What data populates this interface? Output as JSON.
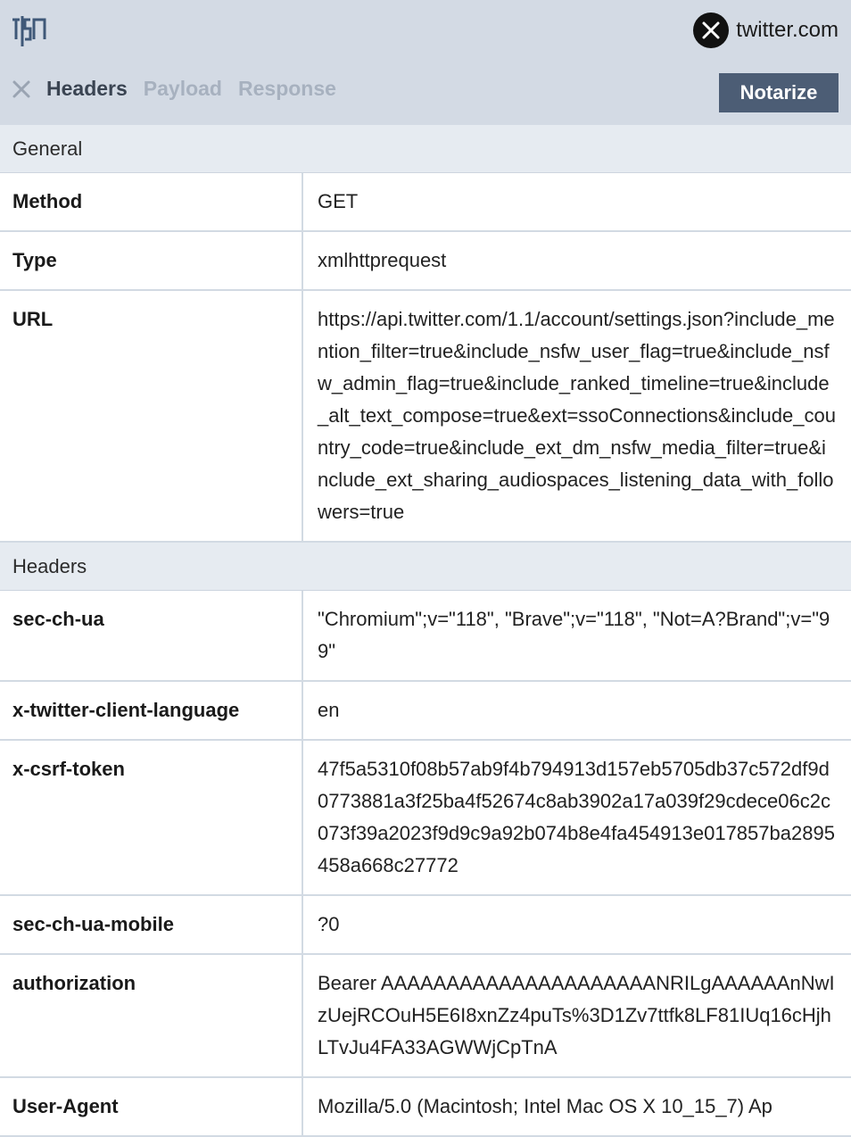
{
  "header": {
    "site": "twitter.com",
    "tabs": [
      {
        "label": "Headers",
        "active": true
      },
      {
        "label": "Payload",
        "active": false
      },
      {
        "label": "Response",
        "active": false
      }
    ],
    "notarize_label": "Notarize"
  },
  "icons": {
    "logo": "tlsn-logo-icon",
    "site": "x-logo-icon",
    "close": "close-icon"
  },
  "colors": {
    "topbar": "#d3dae4",
    "section": "#e6ebf1",
    "button": "#4c5d75",
    "tab_active": "#3a4452",
    "tab_inactive": "#a7b1bf"
  },
  "general": {
    "title": "General",
    "rows": [
      {
        "key": "Method",
        "value": "GET"
      },
      {
        "key": "Type",
        "value": "xmlhttprequest"
      },
      {
        "key": "URL",
        "value": "https://api.twitter.com/1.1/account/settings.json?include_mention_filter=true&include_nsfw_user_flag=true&include_nsfw_admin_flag=true&include_ranked_timeline=true&include_alt_text_compose=true&ext=ssoConnections&include_country_code=true&include_ext_dm_nsfw_media_filter=true&include_ext_sharing_audiospaces_listening_data_with_followers=true"
      }
    ]
  },
  "headers": {
    "title": "Headers",
    "rows": [
      {
        "key": "sec-ch-ua",
        "value": "\"Chromium\";v=\"118\", \"Brave\";v=\"118\", \"Not=A?Brand\";v=\"99\""
      },
      {
        "key": "x-twitter-client-language",
        "value": "en"
      },
      {
        "key": "x-csrf-token",
        "value": "47f5a5310f08b57ab9f4b794913d157eb5705db37c572df9d0773881a3f25ba4f52674c8ab3902a17a039f29cdece06c2c073f39a2023f9d9c9a92b074b8e4fa454913e017857ba2895458a668c27772"
      },
      {
        "key": "sec-ch-ua-mobile",
        "value": "?0"
      },
      {
        "key": "authorization",
        "value": "Bearer AAAAAAAAAAAAAAAAAAAAANRILgAAAAAAnNwIzUejRCOuH5E6I8xnZz4puTs%3D1Zv7ttfk8LF81IUq16cHjhLTvJu4FA33AGWWjCpTnA"
      },
      {
        "key": "User-Agent",
        "value": "Mozilla/5.0 (Macintosh; Intel Mac OS X 10_15_7) Ap"
      }
    ]
  }
}
